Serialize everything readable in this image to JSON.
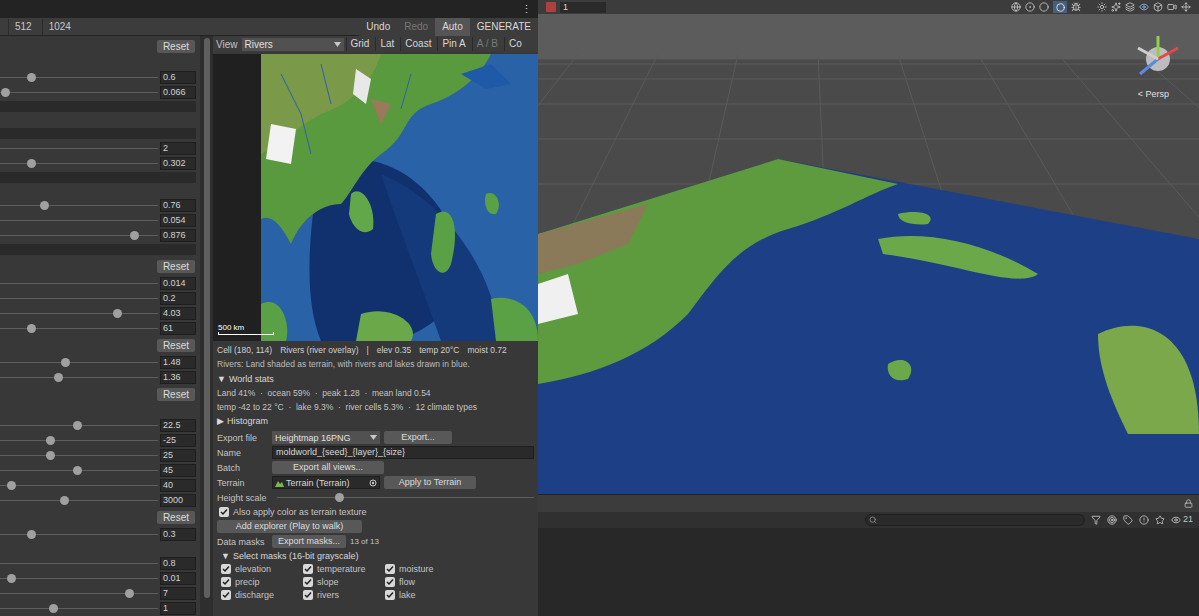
{
  "editor": {
    "menu_glyph": "⋮",
    "resolution_tabs": [
      {
        "label": "512",
        "selected": false
      },
      {
        "label": "1024",
        "selected": false
      }
    ],
    "actions": [
      {
        "label": "Undo",
        "disabled": false,
        "selected": false
      },
      {
        "label": "Redo",
        "disabled": true,
        "selected": false
      },
      {
        "label": "Auto",
        "disabled": false,
        "selected": true
      },
      {
        "label": "GENERATE",
        "disabled": false,
        "selected": false
      }
    ]
  },
  "parameters": [
    {
      "kind": "reset",
      "label": "Reset"
    },
    {
      "kind": "blank"
    },
    {
      "kind": "slider",
      "value": "0.6",
      "level": 0.18
    },
    {
      "kind": "slider",
      "value": "0.066",
      "level": 0.01
    },
    {
      "kind": "bar"
    },
    {
      "kind": "blank"
    },
    {
      "kind": "bar"
    },
    {
      "kind": "number",
      "value": "2"
    },
    {
      "kind": "slider",
      "value": "0.302",
      "level": 0.18
    },
    {
      "kind": "bar"
    },
    {
      "kind": "blank"
    },
    {
      "kind": "slider",
      "value": "0.76",
      "level": 0.27
    },
    {
      "kind": "number",
      "value": "0.054"
    },
    {
      "kind": "slider",
      "value": "0.876",
      "level": 0.87
    },
    {
      "kind": "bar"
    },
    {
      "kind": "reset",
      "label": "Reset"
    },
    {
      "kind": "number",
      "value": "0.014"
    },
    {
      "kind": "number",
      "value": "0.2"
    },
    {
      "kind": "slider",
      "value": "4.03",
      "level": 0.76
    },
    {
      "kind": "slider",
      "value": "61",
      "level": 0.18
    },
    {
      "kind": "reset",
      "label": "Reset"
    },
    {
      "kind": "slider",
      "value": "1.48",
      "level": 0.41
    },
    {
      "kind": "slider",
      "value": "1.36",
      "level": 0.36
    },
    {
      "kind": "reset",
      "label": "Reset"
    },
    {
      "kind": "blank"
    },
    {
      "kind": "slider",
      "value": "22.5",
      "level": 0.49
    },
    {
      "kind": "slider",
      "value": "-25",
      "level": 0.31
    },
    {
      "kind": "slider",
      "value": "25",
      "level": 0.31
    },
    {
      "kind": "slider",
      "value": "45",
      "level": 0.49
    },
    {
      "kind": "slider",
      "value": "40",
      "level": 0.05
    },
    {
      "kind": "slider",
      "value": "3000",
      "level": 0.4
    },
    {
      "kind": "reset",
      "label": "Reset"
    },
    {
      "kind": "slider",
      "value": "0.3",
      "level": 0.18
    },
    {
      "kind": "blank"
    },
    {
      "kind": "number",
      "value": "0.8"
    },
    {
      "kind": "slider",
      "value": "0.01",
      "level": 0.05
    },
    {
      "kind": "slider",
      "value": "7",
      "level": 0.84
    },
    {
      "kind": "slider",
      "value": "1",
      "level": 0.33
    }
  ],
  "view_bar": {
    "label": "View",
    "dropdown": "Rivers",
    "toggles": [
      {
        "label": "Grid",
        "disabled": false
      },
      {
        "label": "Lat",
        "disabled": false
      },
      {
        "label": "Coast",
        "disabled": false
      },
      {
        "label": "Pin A",
        "disabled": false
      },
      {
        "label": "A / B",
        "disabled": true
      },
      {
        "label": "Co",
        "disabled": false
      }
    ]
  },
  "map": {
    "scale": "500 km"
  },
  "info": {
    "cell": "Cell (180, 114)",
    "layer": "Rivers (river overlay)",
    "separator": "|",
    "readings": [
      "elev 0.35",
      "temp 20°C",
      "moist 0.72"
    ],
    "description": "Rivers: Land shaded as terrain, with rivers and lakes drawn in blue."
  },
  "world_stats": {
    "arrow": "▼",
    "label": "World stats",
    "expanded": true,
    "lines": [
      "Land 41%  ·  ocean 59%  ·  peak 1.28  ·  mean land 0.54",
      "temp -42 to 22 °C  ·  lake 9.3%  ·  river cells 5.3%  ·  12 climate types"
    ]
  },
  "histogram": {
    "arrow": "▶",
    "label": "Histogram",
    "expanded": false
  },
  "export": {
    "file_label": "Export file",
    "format": "Heightmap 16PNG",
    "export_button": "Export...",
    "name_label": "Name",
    "name_value": "moldworld_{seed}_{layer}_{size}",
    "batch_label": "Batch",
    "batch_button": "Export all views...",
    "terrain_label": "Terrain",
    "terrain_value": "Terrain (Terrain)",
    "apply_button": "Apply to Terrain"
  },
  "height_scale": {
    "label": "Height scale",
    "level": 0.23
  },
  "apply_color": {
    "label": "Also apply color as terrain texture",
    "checked": true
  },
  "explorer_button": "Add explorer (Play to walk)",
  "data_masks": {
    "label": "Data masks",
    "button": "Export masks...",
    "count": "13 of 13"
  },
  "select_masks": {
    "arrow": "▼",
    "label": "Select masks (16-bit grayscale)",
    "expanded": true,
    "items": [
      {
        "label": "elevation",
        "checked": true
      },
      {
        "label": "temperature",
        "checked": true
      },
      {
        "label": "moisture",
        "checked": true
      },
      {
        "label": "precip",
        "checked": true
      },
      {
        "label": "slope",
        "checked": true
      },
      {
        "label": "flow",
        "checked": true
      },
      {
        "label": "discharge",
        "checked": true
      },
      {
        "label": "rivers",
        "checked": true
      },
      {
        "label": "lake",
        "checked": true
      }
    ]
  },
  "scene": {
    "layer_field": "1",
    "projection": "< Persp",
    "visible_count": "21"
  }
}
